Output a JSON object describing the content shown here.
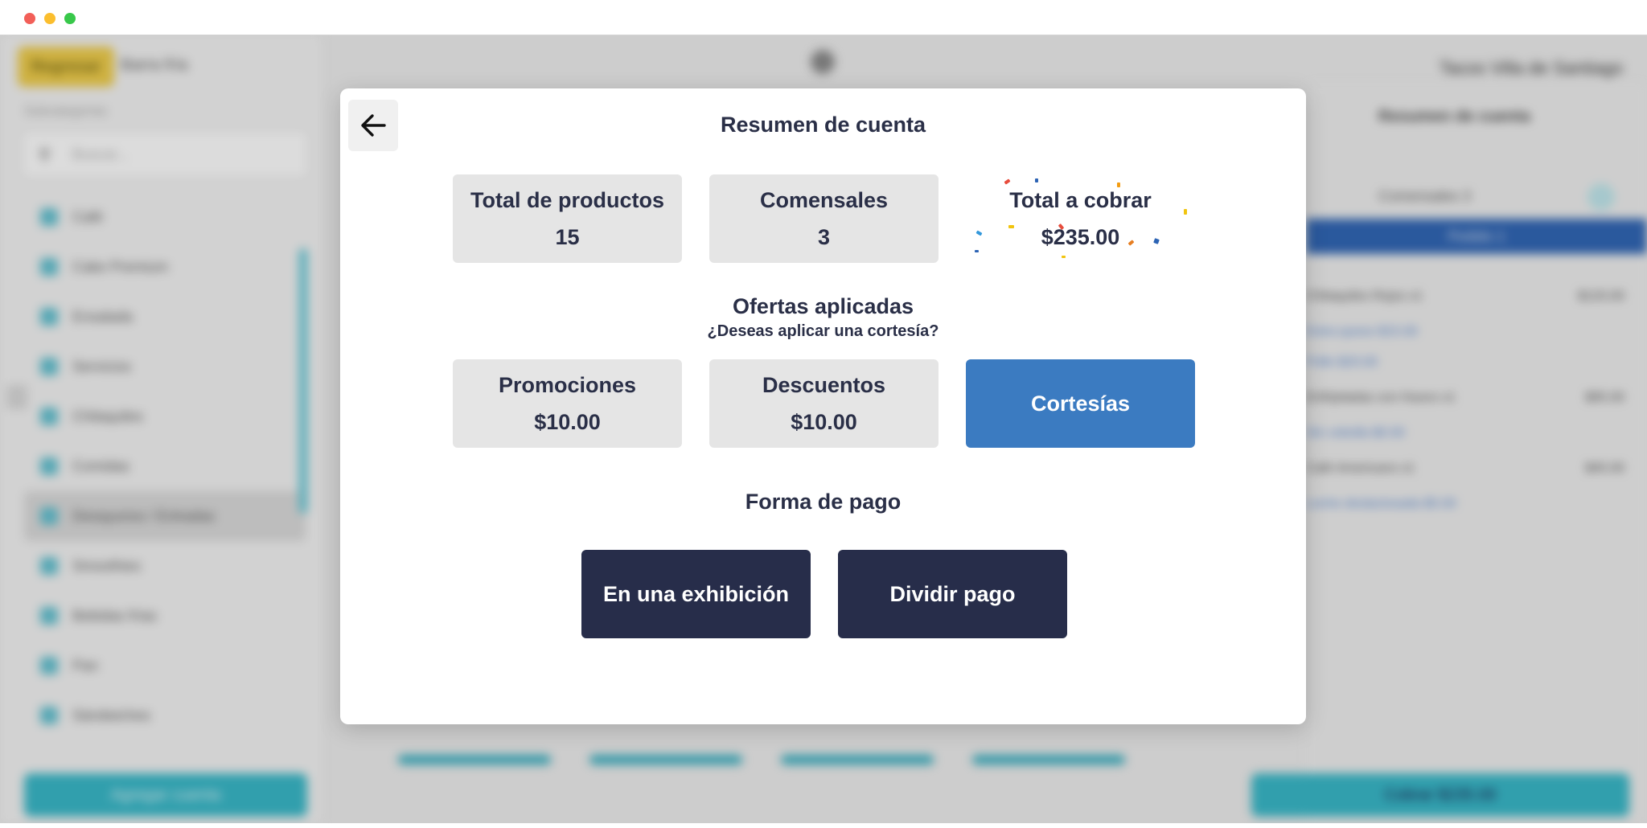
{
  "window": {
    "controls": [
      "close",
      "minimize",
      "zoom"
    ]
  },
  "background": {
    "header": {
      "back_button": "Regresar",
      "back_label": "Barra fría",
      "right_title": "Tacos Villa de Santiago"
    },
    "sidebar": {
      "categories_label": "Subcategorías",
      "search_placeholder": "Buscar...",
      "items": [
        {
          "label": "Café"
        },
        {
          "label": "Cake Premium"
        },
        {
          "label": "Ensalada"
        },
        {
          "label": "Servicios"
        },
        {
          "label": "Chilaquiles"
        },
        {
          "label": "Comidas"
        },
        {
          "label": "Desayunos / Entradas"
        },
        {
          "label": "Smoothies"
        },
        {
          "label": "Bebidas frías"
        },
        {
          "label": "Pan"
        },
        {
          "label": "Sándwiches"
        }
      ],
      "add_button": "Agregar cuenta"
    },
    "right_panel": {
      "title": "Resumen de cuenta",
      "subtitle": "Comensales 3",
      "bar_label": "Pedido 1",
      "lines": [
        {
          "text": "Chilaquiles Rojos x1",
          "type": "item",
          "amount": "$120.00"
        },
        {
          "text": "Extra queso $15.00",
          "type": "mod"
        },
        {
          "text": "Pollo $20.00",
          "type": "mod"
        },
        {
          "text": "Enfrijoladas con Huevo x1",
          "type": "item",
          "amount": "$95.00"
        },
        {
          "text": "Sin cebolla $0.00",
          "type": "mod"
        },
        {
          "text": "Café Americano x1",
          "type": "item",
          "amount": "$45.00"
        },
        {
          "text": "Leche deslactosada $5.00",
          "type": "mod"
        }
      ],
      "cobrar_button": "Cobrar $235.00"
    }
  },
  "modal": {
    "back_icon": "arrow-left-icon",
    "title": "Resumen de cuenta",
    "stats": {
      "products": {
        "label": "Total de productos",
        "value": "15"
      },
      "diners": {
        "label": "Comensales",
        "value": "3"
      },
      "total": {
        "label": "Total a cobrar",
        "value": "$235.00"
      }
    },
    "offers": {
      "title": "Ofertas aplicadas",
      "subtitle": "¿Deseas aplicar una cortesía?",
      "promotions": {
        "label": "Promociones",
        "value": "$10.00"
      },
      "discounts": {
        "label": "Descuentos",
        "value": "$10.00"
      },
      "courtesies_button": "Cortesías"
    },
    "payment": {
      "title": "Forma de pago",
      "single_button": "En una exhibición",
      "split_button": "Dividir pago"
    }
  },
  "colors": {
    "primary_dark": "#272d4a",
    "accent_blue": "#3b7bc1",
    "card_gray": "#e5e5e5",
    "text_dark": "#2a2f47",
    "teal": "#34b7c8",
    "yellow": "#f0cd47"
  }
}
